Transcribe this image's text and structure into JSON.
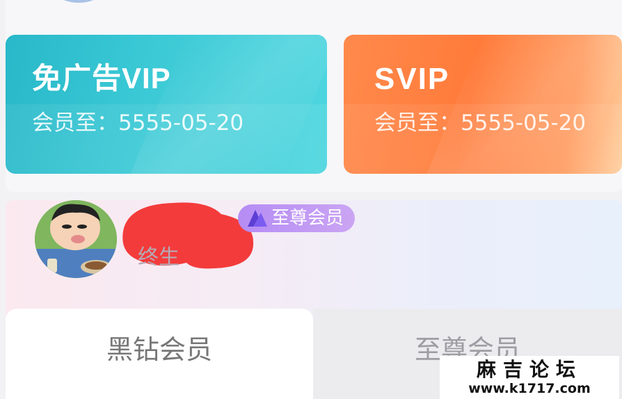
{
  "cards": [
    {
      "title": "免广告VIP",
      "expire": "会员至：5555-05-20",
      "color": "#3ccad6"
    },
    {
      "title": "SVIP",
      "expire": "会员至：5555-05-20",
      "color": "#ff7b3a"
    }
  ],
  "profile": {
    "badge": "至尊会员",
    "subtitle": "终生",
    "badge_color": "#b58cf4"
  },
  "tabs": [
    {
      "label": "黑钻会员",
      "active": true
    },
    {
      "label": "至尊会员",
      "active": false
    }
  ],
  "watermark": {
    "title": "麻吉论坛",
    "url": "www.k1717.com"
  }
}
